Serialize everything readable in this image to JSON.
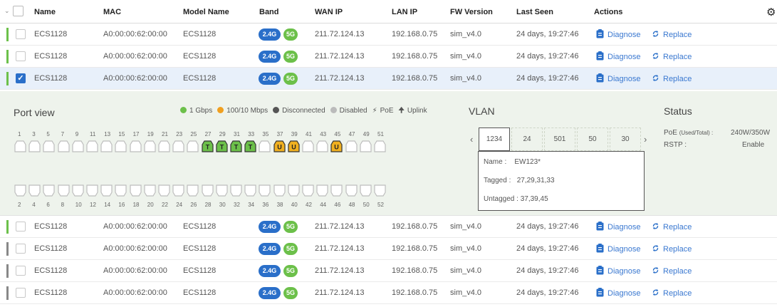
{
  "header": {
    "columns": [
      "Name",
      "MAC",
      "Model Name",
      "Band",
      "WAN IP",
      "LAN IP",
      "FW Version",
      "Last Seen",
      "Actions"
    ],
    "settings_icon": "gear-icon",
    "expand_icon": "chevron-down-icon"
  },
  "rows": [
    {
      "name": "ECS1128",
      "mac": "A0:00:00:62:00:00",
      "model": "ECS1128",
      "band_24": "2.4G",
      "band_5": "5G",
      "wan_ip": "211.72.124.13",
      "lan_ip": "192.168.0.75",
      "fw": "sim_v4.0",
      "last_seen": "24 days, 19:27:46",
      "diagnose": "Diagnose",
      "replace": "Replace",
      "status_color": "#6cc04a",
      "checked": false
    },
    {
      "name": "ECS1128",
      "mac": "A0:00:00:62:00:00",
      "model": "ECS1128",
      "band_24": "2.4G",
      "band_5": "5G",
      "wan_ip": "211.72.124.13",
      "lan_ip": "192.168.0.75",
      "fw": "sim_v4.0",
      "last_seen": "24 days, 19:27:46",
      "diagnose": "Diagnose",
      "replace": "Replace",
      "status_color": "#6cc04a",
      "checked": false
    },
    {
      "name": "ECS1128",
      "mac": "A0:00:00:62:00:00",
      "model": "ECS1128",
      "band_24": "2.4G",
      "band_5": "5G",
      "wan_ip": "211.72.124.13",
      "lan_ip": "192.168.0.75",
      "fw": "sim_v4.0",
      "last_seen": "24 days, 19:27:46",
      "diagnose": "Diagnose",
      "replace": "Replace",
      "status_color": "#6cc04a",
      "checked": true
    },
    {
      "name": "ECS1128",
      "mac": "A0:00:00:62:00:00",
      "model": "ECS1128",
      "band_24": "2.4G",
      "band_5": "5G",
      "wan_ip": "211.72.124.13",
      "lan_ip": "192.168.0.75",
      "fw": "sim_v4.0",
      "last_seen": "24 days, 19:27:46",
      "diagnose": "Diagnose",
      "replace": "Replace",
      "status_color": "#6cc04a",
      "checked": false
    },
    {
      "name": "ECS1128",
      "mac": "A0:00:00:62:00:00",
      "model": "ECS1128",
      "band_24": "2.4G",
      "band_5": "5G",
      "wan_ip": "211.72.124.13",
      "lan_ip": "192.168.0.75",
      "fw": "sim_v4.0",
      "last_seen": "24 days, 19:27:46",
      "diagnose": "Diagnose",
      "replace": "Replace",
      "status_color": "#888888",
      "checked": false
    },
    {
      "name": "ECS1128",
      "mac": "A0:00:00:62:00:00",
      "model": "ECS1128",
      "band_24": "2.4G",
      "band_5": "5G",
      "wan_ip": "211.72.124.13",
      "lan_ip": "192.168.0.75",
      "fw": "sim_v4.0",
      "last_seen": "24 days, 19:27:46",
      "diagnose": "Diagnose",
      "replace": "Replace",
      "status_color": "#888888",
      "checked": false
    },
    {
      "name": "ECS1128",
      "mac": "A0:00:00:62:00:00",
      "model": "ECS1128",
      "band_24": "2.4G",
      "band_5": "5G",
      "wan_ip": "211.72.124.13",
      "lan_ip": "192.168.0.75",
      "fw": "sim_v4.0",
      "last_seen": "24 days, 19:27:46",
      "diagnose": "Diagnose",
      "replace": "Replace",
      "status_color": "#888888",
      "checked": false
    }
  ],
  "port_view": {
    "title": "Port view",
    "legend": [
      {
        "label": "1 Gbps",
        "color": "#6cc04a",
        "icon": "dot"
      },
      {
        "label": "100/10 Mbps",
        "color": "#f0a020",
        "icon": "dot"
      },
      {
        "label": "Disconnected",
        "color": "#555555",
        "icon": "dot"
      },
      {
        "label": "Disabled",
        "color": "#bbbbbb",
        "icon": "dot"
      },
      {
        "label": "PoE",
        "color": "#222222",
        "icon": "bolt"
      },
      {
        "label": "Uplink",
        "color": "#222222",
        "icon": "arrow-up"
      }
    ],
    "top_numbers": [
      "1",
      "3",
      "5",
      "7",
      "9",
      "11",
      "13",
      "15",
      "17",
      "19",
      "21",
      "23",
      "25",
      "27",
      "29",
      "31",
      "33",
      "35",
      "37",
      "39",
      "41",
      "43",
      "45",
      "47",
      "49",
      "51"
    ],
    "bottom_numbers": [
      "2",
      "4",
      "6",
      "8",
      "10",
      "12",
      "14",
      "16",
      "18",
      "20",
      "22",
      "24",
      "26",
      "28",
      "30",
      "32",
      "34",
      "36",
      "38",
      "40",
      "42",
      "44",
      "46",
      "48",
      "50",
      "52"
    ],
    "top_ports": [
      "d",
      "d",
      "d",
      "d",
      "d",
      "d",
      "d",
      "d",
      "d",
      "d",
      "d",
      "d",
      "d",
      "g",
      "g",
      "g",
      "g",
      "d",
      "y",
      "y",
      "d",
      "d",
      "y",
      "d",
      "d",
      "d"
    ],
    "bottom_ports": [
      "d",
      "d",
      "d",
      "d",
      "d",
      "d",
      "d",
      "d",
      "d",
      "d",
      "d",
      "d",
      "d",
      "d",
      "d",
      "d",
      "d",
      "d",
      "d",
      "d",
      "d",
      "d",
      "d",
      "d",
      "d",
      "d"
    ],
    "top_port_letters": [
      "",
      "",
      "",
      "",
      "",
      "",
      "",
      "",
      "",
      "",
      "",
      "",
      "",
      "T",
      "T",
      "T",
      "T",
      "",
      "U",
      "U",
      "",
      "",
      "U",
      "",
      "",
      ""
    ]
  },
  "vlan": {
    "title": "VLAN",
    "tabs": [
      "1234",
      "24",
      "501",
      "50",
      "30"
    ],
    "active_tab": 0,
    "name_label": "Name :",
    "name_value": "EW123*",
    "tagged_label": "Tagged :",
    "tagged_value": "27,29,31,33",
    "untagged_label": "Untagged :",
    "untagged_value": "37,39,45"
  },
  "status": {
    "title": "Status",
    "poe_label": "PoE",
    "poe_sub": "(Used/Total) :",
    "poe_value": "240W/350W",
    "rstp_label": "RSTP :",
    "rstp_value": "Enable"
  }
}
